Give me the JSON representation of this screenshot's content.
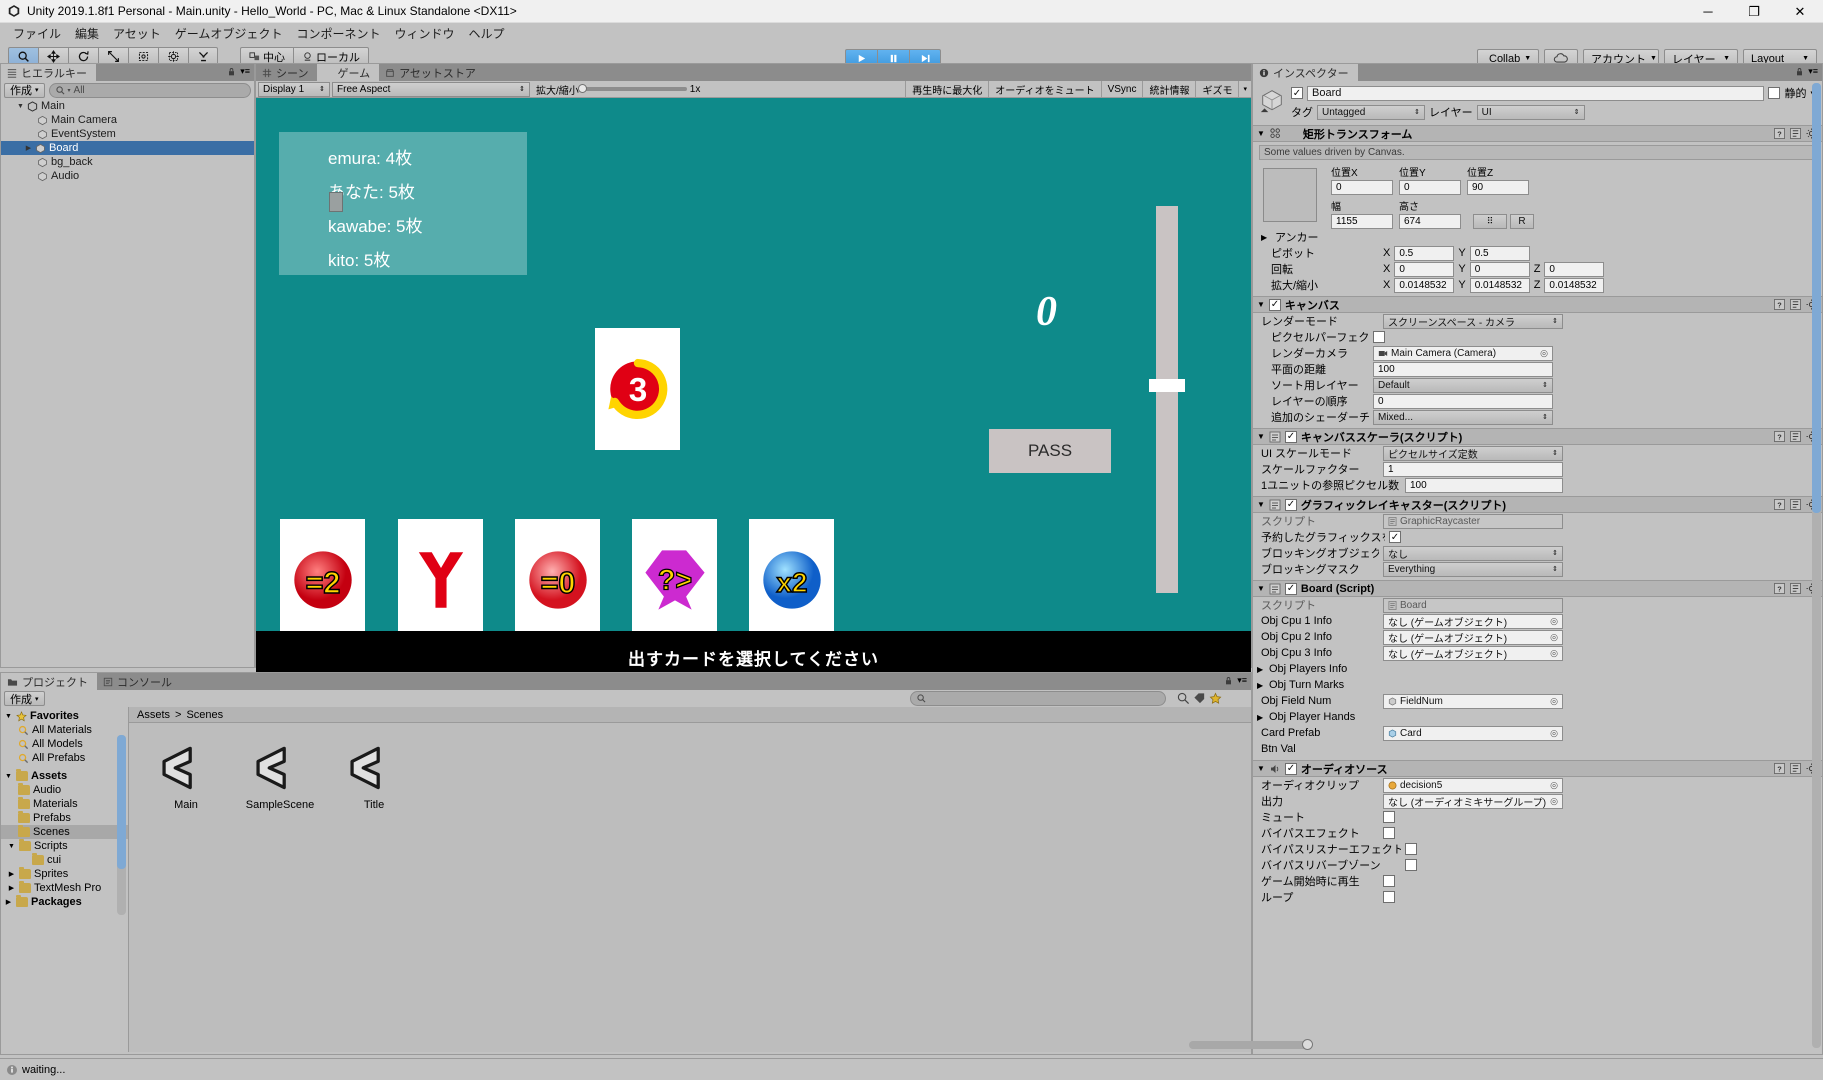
{
  "window": {
    "title": "Unity 2019.1.8f1 Personal - Main.unity - Hello_World - PC, Mac & Linux Standalone <DX11>",
    "minimize": "─",
    "maximize": "❐",
    "close": "✕"
  },
  "menu": {
    "items": [
      "ファイル",
      "編集",
      "アセット",
      "ゲームオブジェクト",
      "コンポーネント",
      "ウィンドウ",
      "ヘルプ"
    ]
  },
  "toolbar": {
    "tools": [
      "hand-icon",
      "move-icon",
      "rotate-icon",
      "scale-icon",
      "rect-icon",
      "transform-icon",
      "custom-icon"
    ],
    "pivot_mode": "中心",
    "pivot_rotation": "ローカル",
    "play": "play-icon",
    "pause": "pause-icon",
    "step": "step-icon",
    "collab": "Collab",
    "cloud": "cloud-icon",
    "account": "アカウント",
    "layers": "レイヤー",
    "layout": "Layout"
  },
  "hierarchy": {
    "tab": "ヒエラルキー",
    "create": "作成",
    "search_placeholder": "All",
    "items": [
      {
        "label": "Main",
        "depth": 0,
        "arrow": "▼",
        "icon": "unity-scene-icon",
        "selected": false
      },
      {
        "label": "Main Camera",
        "depth": 1,
        "arrow": "",
        "icon": "gameobject-icon",
        "selected": false
      },
      {
        "label": "EventSystem",
        "depth": 1,
        "arrow": "",
        "icon": "gameobject-icon",
        "selected": false
      },
      {
        "label": "Board",
        "depth": 1,
        "arrow": "▶",
        "icon": "gameobject-icon",
        "selected": true
      },
      {
        "label": "bg_back",
        "depth": 1,
        "arrow": "",
        "icon": "gameobject-icon",
        "selected": false
      },
      {
        "label": "Audio",
        "depth": 1,
        "arrow": "",
        "icon": "gameobject-icon",
        "selected": false
      }
    ]
  },
  "gameview": {
    "tabs": [
      {
        "label": "シーン",
        "icon": "scene-icon",
        "selected": false
      },
      {
        "label": "ゲーム",
        "icon": "game-icon",
        "selected": true
      },
      {
        "label": "アセットストア",
        "icon": "store-icon",
        "selected": false
      }
    ],
    "display": "Display 1",
    "aspect": "Free Aspect",
    "scale_label": "拡大/縮小",
    "scale_value": "1x",
    "maximize_on_play": "再生時に最大化",
    "mute_audio": "オーディオをミュート",
    "vsync": "VSync",
    "stats": "統計情報",
    "gizmos": "ギズモ"
  },
  "game": {
    "background_color": "#0e8a8a",
    "scores": [
      "emura: 4枚",
      "あなた: 5枚",
      "kawabe: 5枚",
      "kito: 5枚"
    ],
    "field_number": "0",
    "pass_button": "PASS",
    "message": "出すカードを選択してください",
    "center_card": {
      "label": "3",
      "type": "draw-three-red"
    },
    "hand_cards": [
      {
        "label": "=2",
        "type": "red-equals-two"
      },
      {
        "label": "Y",
        "type": "red-y"
      },
      {
        "label": "=0",
        "type": "red-equals-zero"
      },
      {
        "label": "?>",
        "type": "purple-question"
      },
      {
        "label": "x2",
        "type": "blue-times-two"
      }
    ]
  },
  "inspector": {
    "tab": "インスペクター",
    "object_name": "Board",
    "object_enabled": true,
    "static_label": "静的",
    "tag_label": "タグ",
    "tag_value": "Untagged",
    "layer_label": "レイヤー",
    "layer_value": "UI",
    "components": [
      {
        "title": "矩形トランスフォーム",
        "info": "Some values driven by Canvas.",
        "rect": {
          "pos_x_label": "位置X",
          "pos_x": "0",
          "pos_y_label": "位置Y",
          "pos_y": "0",
          "pos_z_label": "位置Z",
          "pos_z": "90",
          "width_label": "幅",
          "width": "1155",
          "height_label": "高さ",
          "height": "674",
          "blueprint": "R",
          "anchor_label": "アンカー",
          "pivot_label": "ピボット",
          "pivot_x": "0.5",
          "pivot_y": "0.5",
          "rotation_label": "回転",
          "rot_x": "0",
          "rot_y": "0",
          "rot_z": "0",
          "scale_label": "拡大/縮小",
          "scale_x": "0.0148532",
          "scale_y": "0.0148532",
          "scale_z": "0.0148532"
        }
      },
      {
        "title": "キャンバス",
        "rows": [
          {
            "label": "レンダーモード",
            "value": "スクリーンスペース - カメラ",
            "type": "dropdown"
          },
          {
            "label": "ピクセルパーフェクト",
            "value": "",
            "type": "checkbox",
            "checked": false
          },
          {
            "label": "レンダーカメラ",
            "value": "Main Camera (Camera)",
            "type": "object"
          },
          {
            "label": "平面の距離",
            "value": "100",
            "type": "number"
          },
          {
            "label": "ソート用レイヤー",
            "value": "Default",
            "type": "dropdown"
          },
          {
            "label": "レイヤーの順序",
            "value": "0",
            "type": "number"
          },
          {
            "label": "追加のシェーダーチャンネル",
            "value": "Mixed...",
            "type": "dropdown"
          }
        ]
      },
      {
        "title": "キャンバススケーラ(スクリプト)",
        "rows": [
          {
            "label": "UI スケールモード",
            "value": "ピクセルサイズ定数",
            "type": "dropdown"
          },
          {
            "label": "スケールファクター",
            "value": "1",
            "type": "number"
          },
          {
            "label": "1ユニットの参照ピクセル数",
            "value": "100",
            "type": "number"
          }
        ]
      },
      {
        "title": "グラフィックレイキャスター(スクリプト)",
        "rows": [
          {
            "label": "スクリプト",
            "value": "GraphicRaycaster",
            "type": "object"
          },
          {
            "label": "予約したグラフィックスを無視",
            "value": "",
            "type": "checkbox",
            "checked": true
          },
          {
            "label": "ブロッキングオブジェクト",
            "value": "なし",
            "type": "dropdown"
          },
          {
            "label": "ブロッキングマスク",
            "value": "Everything",
            "type": "dropdown"
          }
        ]
      },
      {
        "title": "Board (Script)",
        "rows": [
          {
            "label": "スクリプト",
            "value": "Board",
            "type": "object"
          },
          {
            "label": "Obj Cpu 1 Info",
            "value": "なし (ゲームオブジェクト)",
            "type": "object"
          },
          {
            "label": "Obj Cpu 2 Info",
            "value": "なし (ゲームオブジェクト)",
            "type": "object"
          },
          {
            "label": "Obj Cpu 3 Info",
            "value": "なし (ゲームオブジェクト)",
            "type": "object"
          },
          {
            "label": "Obj Players Info",
            "value": "",
            "type": "foldout"
          },
          {
            "label": "Obj Turn Marks",
            "value": "",
            "type": "foldout"
          },
          {
            "label": "Obj Field Num",
            "value": "FieldNum",
            "type": "object"
          },
          {
            "label": "Obj Player Hands",
            "value": "",
            "type": "foldout"
          },
          {
            "label": "Card Prefab",
            "value": "Card",
            "type": "object"
          },
          {
            "label": "Btn Val",
            "value": "",
            "type": "empty"
          }
        ]
      },
      {
        "title": "オーディオソース",
        "rows": [
          {
            "label": "オーディオクリップ",
            "value": "decision5",
            "type": "object"
          },
          {
            "label": "出力",
            "value": "なし (オーディオミキサーグループ)",
            "type": "object"
          },
          {
            "label": "ミュート",
            "value": "",
            "type": "checkbox",
            "checked": false
          },
          {
            "label": "バイパスエフェクト",
            "value": "",
            "type": "checkbox",
            "checked": false
          },
          {
            "label": "バイパスリスナーエフェクト",
            "value": "",
            "type": "checkbox",
            "checked": false
          },
          {
            "label": "バイパスリバーブゾーン",
            "value": "",
            "type": "checkbox",
            "checked": false
          },
          {
            "label": "ゲーム開始時に再生",
            "value": "",
            "type": "checkbox",
            "checked": false
          },
          {
            "label": "ループ",
            "value": "",
            "type": "checkbox",
            "checked": false
          }
        ]
      }
    ]
  },
  "project": {
    "tabs": [
      {
        "label": "プロジェクト",
        "icon": "project-icon",
        "selected": true
      },
      {
        "label": "コンソール",
        "icon": "console-icon",
        "selected": false
      }
    ],
    "create": "作成",
    "search_placeholder": "",
    "tree": [
      {
        "label": "Favorites",
        "depth": 0,
        "arrow": "▼",
        "icon": "star-icon",
        "selected": false
      },
      {
        "label": "All Materials",
        "depth": 1,
        "arrow": "",
        "icon": "search-icon",
        "selected": false
      },
      {
        "label": "All Models",
        "depth": 1,
        "arrow": "",
        "icon": "search-icon",
        "selected": false
      },
      {
        "label": "All Prefabs",
        "depth": 1,
        "arrow": "",
        "icon": "search-icon",
        "selected": false
      },
      {
        "label": "Assets",
        "depth": 0,
        "arrow": "▼",
        "icon": "folder-icon",
        "selected": false
      },
      {
        "label": "Audio",
        "depth": 1,
        "arrow": "",
        "icon": "folder-icon",
        "selected": false
      },
      {
        "label": "Materials",
        "depth": 1,
        "arrow": "",
        "icon": "folder-icon",
        "selected": false
      },
      {
        "label": "Prefabs",
        "depth": 1,
        "arrow": "",
        "icon": "folder-icon",
        "selected": false
      },
      {
        "label": "Scenes",
        "depth": 1,
        "arrow": "",
        "icon": "folder-icon",
        "selected": true
      },
      {
        "label": "Scripts",
        "depth": 1,
        "arrow": "▼",
        "icon": "folder-icon",
        "selected": false
      },
      {
        "label": "cui",
        "depth": 2,
        "arrow": "",
        "icon": "folder-icon",
        "selected": false
      },
      {
        "label": "Sprites",
        "depth": 1,
        "arrow": "▶",
        "icon": "folder-icon",
        "selected": false
      },
      {
        "label": "TextMesh Pro",
        "depth": 1,
        "arrow": "▶",
        "icon": "folder-icon",
        "selected": false
      },
      {
        "label": "Packages",
        "depth": 0,
        "arrow": "▶",
        "icon": "folder-icon",
        "selected": false
      }
    ],
    "breadcrumb": [
      "Assets",
      "Scenes"
    ],
    "assets": [
      {
        "label": "Main",
        "icon": "unity-scene-asset-icon"
      },
      {
        "label": "SampleScene",
        "icon": "unity-scene-asset-icon"
      },
      {
        "label": "Title",
        "icon": "unity-scene-asset-icon"
      }
    ]
  },
  "statusbar": {
    "message": "waiting...",
    "icon": "info-icon"
  }
}
